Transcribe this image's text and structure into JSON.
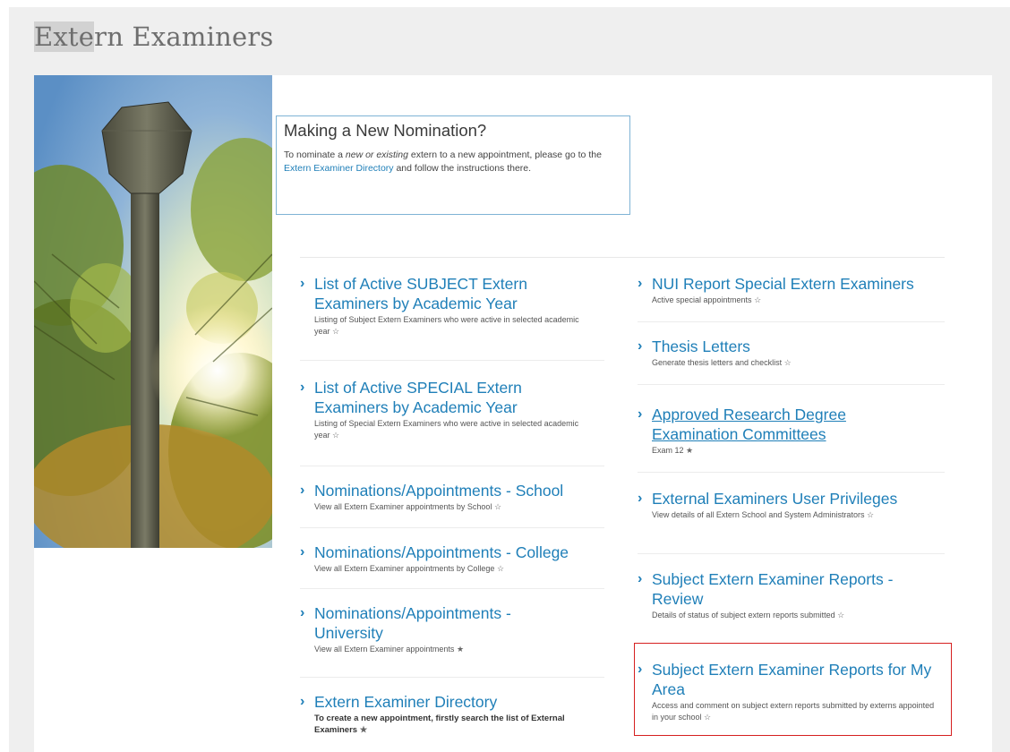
{
  "page": {
    "title_hl": "Exte",
    "title_rest": "rn Examiners"
  },
  "nomination": {
    "title": "Making a New Nomination?",
    "text_1": "To nominate a ",
    "text_em": "new or existing",
    "text_2": " extern to a new appointment, please go to the ",
    "link": "Extern Examiner Directory",
    "text_3": " and follow the instructions there."
  },
  "left_column": [
    {
      "title": "List of Active SUBJECT Extern Examiners by Academic Year",
      "desc": "Listing of Subject Extern Examiners who were active in selected academic year",
      "star": "☆"
    },
    {
      "title": "List of Active SPECIAL Extern Examiners by Academic Year",
      "desc": "Listing of Special Extern Examiners who were active in selected academic year",
      "star": "☆"
    },
    {
      "title": "Nominations/Appointments - School",
      "desc": "View all Extern Examiner appointments by School",
      "star": "☆"
    },
    {
      "title": "Nominations/Appointments - College",
      "desc": "View all Extern Examiner appointments by College",
      "star": "☆"
    },
    {
      "title": "Nominations/Appointments - University",
      "desc": "View all Extern Examiner appointments",
      "star": "★"
    },
    {
      "title": "Extern Examiner Directory",
      "desc": "To create a new appointment, firstly search the list of External Examiners",
      "star": "★"
    }
  ],
  "right_column": [
    {
      "title": "NUI Report Special Extern Examiners",
      "desc": "Active special appointments",
      "star": "☆"
    },
    {
      "title": "Thesis Letters",
      "desc": "Generate thesis letters and checklist",
      "star": "☆"
    },
    {
      "title": "Approved Research Degree Examination Committees",
      "desc": "Exam 12",
      "star": "★"
    },
    {
      "title": "External Examiners User Privileges",
      "desc": "View details of all Extern School and System Administrators",
      "star": "☆"
    },
    {
      "title": "Subject Extern Examiner Reports - Review",
      "desc": "Details of status of subject extern reports submitted",
      "star": "☆"
    },
    {
      "title": "Subject Extern Examiner Reports for My Area",
      "desc": "Access and comment on subject extern reports submitted by externs appointed in your school",
      "star": "☆"
    }
  ],
  "chevron": "›"
}
